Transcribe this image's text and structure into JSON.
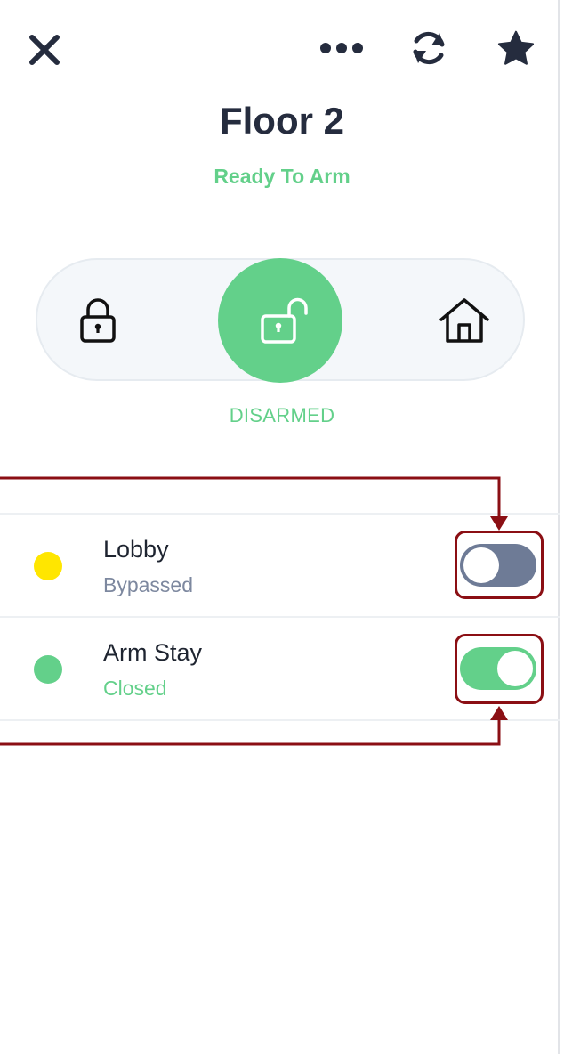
{
  "header": {
    "close_icon": "close-icon",
    "more_icon": "more-icon",
    "refresh_icon": "refresh-icon",
    "favorite_icon": "star-icon",
    "title": "Floor 2",
    "status": "Ready To Arm"
  },
  "mode_selector": {
    "modes": [
      {
        "icon": "lock-icon",
        "name": "arm"
      },
      {
        "icon": "unlock-icon",
        "name": "disarm",
        "selected": true
      },
      {
        "icon": "home-icon",
        "name": "stay"
      }
    ],
    "state_label": "DISARMED"
  },
  "zones": [
    {
      "name": "Lobby",
      "status": "Bypassed",
      "dot_color": "#ffe600",
      "status_color": "#7d889f",
      "enabled": false
    },
    {
      "name": "Arm Stay",
      "status": "Closed",
      "dot_color": "#63d08a",
      "status_color": "#63d08a",
      "enabled": true
    }
  ],
  "colors": {
    "accent_green": "#63d08a",
    "text_dark": "#252c3e",
    "toggle_off": "#6e7b96",
    "annotation": "#8b0f14"
  }
}
